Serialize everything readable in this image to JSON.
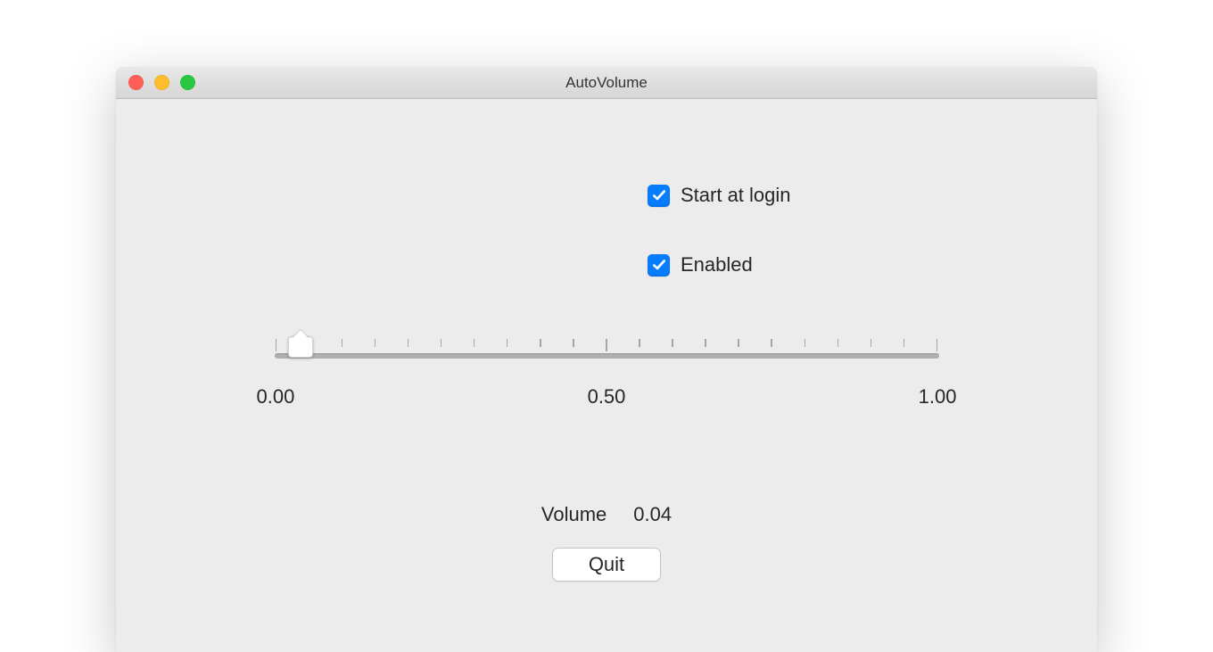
{
  "window": {
    "title": "AutoVolume"
  },
  "checkboxes": {
    "start_at_login": {
      "label": "Start at login",
      "checked": true
    },
    "enabled": {
      "label": "Enabled",
      "checked": true
    }
  },
  "slider": {
    "min": 0.0,
    "max": 1.0,
    "value": 0.04,
    "labels": {
      "min": "0.00",
      "mid": "0.50",
      "max": "1.00"
    }
  },
  "volume": {
    "label": "Volume",
    "value": "0.04"
  },
  "buttons": {
    "quit": "Quit"
  }
}
